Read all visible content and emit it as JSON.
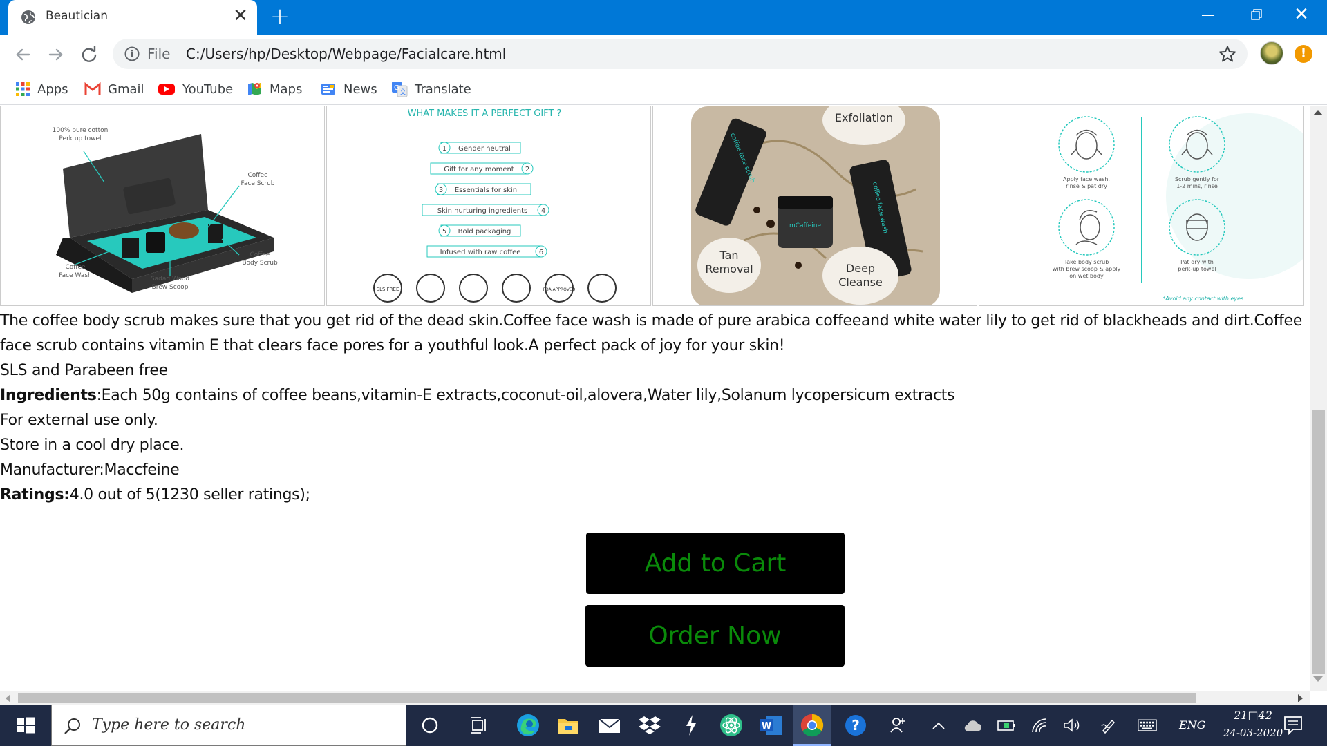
{
  "browser": {
    "tab_title": "Beautician",
    "new_tab_symbol": "+",
    "close_symbol": "✕",
    "omnibox": {
      "scheme": "File",
      "url": "C:/Users/hp/Desktop/Webpage/Facialcare.html"
    },
    "update_badge": "!",
    "bookmarks": [
      {
        "label": "Apps",
        "icon": "apps-grid-icon"
      },
      {
        "label": "Gmail",
        "icon": "gmail-icon"
      },
      {
        "label": "YouTube",
        "icon": "youtube-icon"
      },
      {
        "label": "Maps",
        "icon": "maps-icon"
      },
      {
        "label": "News",
        "icon": "news-icon"
      },
      {
        "label": "Translate",
        "icon": "translate-icon"
      }
    ]
  },
  "gallery": {
    "item1": {
      "labels": [
        "100% pure cotton",
        "Perk up towel",
        "Coffee",
        "Face Scrub",
        "Coffee",
        "Body Scrub",
        "Coffee",
        "Face Wash",
        "Sadad Wood",
        "Brew Scoop"
      ]
    },
    "item2": {
      "heading": "WHAT MAKES IT A PERFECT GIFT ?",
      "features": [
        {
          "num": "1",
          "text": "Gender neutral"
        },
        {
          "num": "2",
          "text": "Gift for any moment"
        },
        {
          "num": "3",
          "text": "Essentials for skin"
        },
        {
          "num": "4",
          "text": "Skin nurturing ingredients"
        },
        {
          "num": "5",
          "text": "Bold packaging"
        },
        {
          "num": "6",
          "text": "Infused with raw coffee"
        }
      ],
      "badges": [
        "SLS FREE",
        "FDA APPROVED"
      ]
    },
    "item3": {
      "labels": [
        "Exfoliation",
        "Tan",
        "Removal",
        "Deep",
        "Cleanse"
      ],
      "product_text": [
        "mCaffeine",
        "coffee face scrub",
        "coffee face wash"
      ]
    },
    "item4": {
      "steps": [
        [
          "Apply face wash,",
          "rinse & pat dry"
        ],
        [
          "Scrub gently for",
          "1-2 mins, rinse"
        ],
        [
          "Take body scrub",
          "with brew scoop & apply",
          "on wet body"
        ],
        [
          "Pat dry with",
          "perk-up towel"
        ]
      ],
      "note": "*Avoid any contact with eyes."
    }
  },
  "product": {
    "description": "The coffee body scrub makes sure that you get rid of the dead skin.Coffee face wash is made of pure arabica coffeeand white water lily to get rid of blackheads and dirt.Coffee face scrub contains vitamin E that clears face pores for a youthful look.A perfect pack of joy for your skin!",
    "sls_line": "SLS and Parabeen free",
    "ingredients_label": "Ingredients",
    "ingredients_value": ":Each 50g contains of coffee beans,vitamin-E extracts,coconut-oil,alovera,Water lily,Solanum lycopersicum extracts",
    "external_use": "For external use only.",
    "storage": "Store in a cool dry place.",
    "manufacturer": "Manufacturer:Maccfeine",
    "ratings_label": "Ratings:",
    "ratings_value": "4.0 out of 5(1230 seller ratings);",
    "add_to_cart": "Add to Cart",
    "order_now": "Order Now"
  },
  "taskbar": {
    "search_placeholder": "Type here to search",
    "language": "ENG",
    "time": "21□42",
    "date": "24-03-2020"
  },
  "colors": {
    "titlebar": "#0078d7",
    "button_bg": "#000000",
    "button_text": "#0a8a0a",
    "taskbar": "#1f2a44"
  }
}
